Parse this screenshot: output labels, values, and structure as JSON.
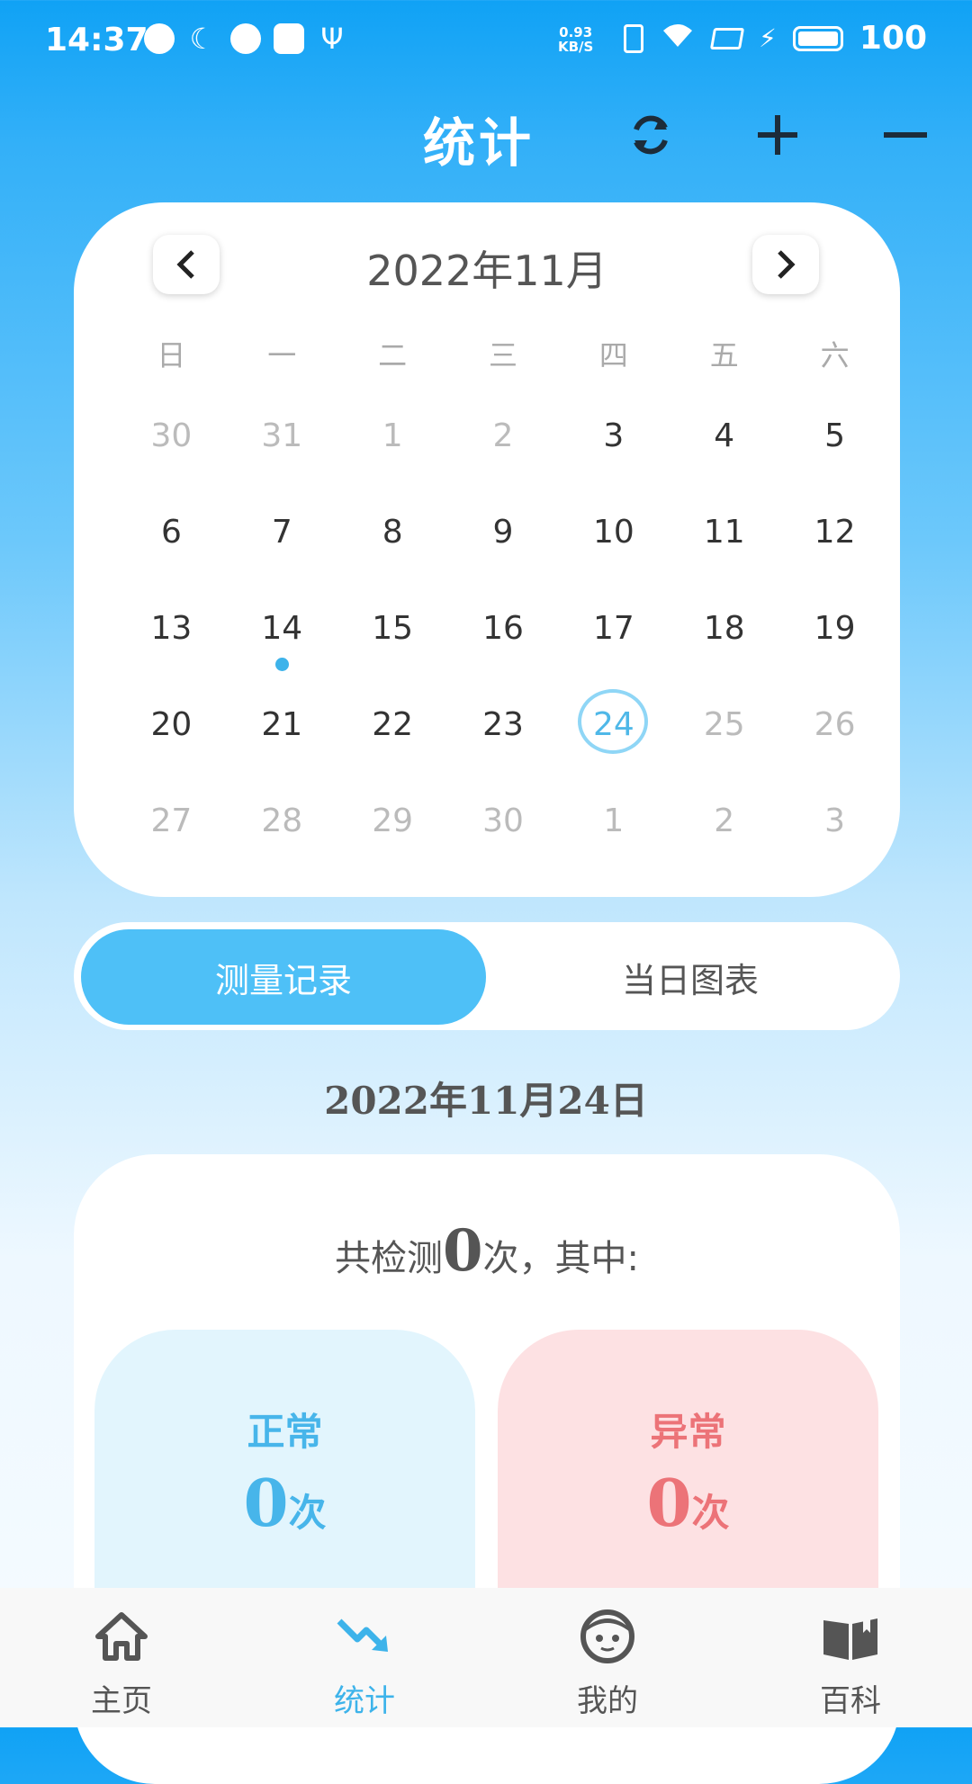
{
  "status_bar": {
    "time": "14:37",
    "net_speed_value": "0.93",
    "net_speed_unit": "KB/S",
    "battery": "100"
  },
  "header": {
    "title": "统计",
    "icons": [
      "refresh-icon",
      "plus-icon",
      "minus-icon"
    ]
  },
  "calendar": {
    "title": "2022年11月",
    "weekdays": [
      "日",
      "一",
      "二",
      "三",
      "四",
      "五",
      "六"
    ],
    "weeks": [
      [
        {
          "d": "30",
          "m": true
        },
        {
          "d": "31",
          "m": true
        },
        {
          "d": "1",
          "m": true
        },
        {
          "d": "2",
          "m": true
        },
        {
          "d": "3"
        },
        {
          "d": "4"
        },
        {
          "d": "5"
        }
      ],
      [
        {
          "d": "6"
        },
        {
          "d": "7"
        },
        {
          "d": "8"
        },
        {
          "d": "9"
        },
        {
          "d": "10"
        },
        {
          "d": "11"
        },
        {
          "d": "12"
        }
      ],
      [
        {
          "d": "13"
        },
        {
          "d": "14",
          "dot": true
        },
        {
          "d": "15"
        },
        {
          "d": "16"
        },
        {
          "d": "17"
        },
        {
          "d": "18"
        },
        {
          "d": "19"
        }
      ],
      [
        {
          "d": "20"
        },
        {
          "d": "21"
        },
        {
          "d": "22"
        },
        {
          "d": "23"
        },
        {
          "d": "24",
          "today": true
        },
        {
          "d": "25",
          "m": true
        },
        {
          "d": "26",
          "m": true
        }
      ],
      [
        {
          "d": "27",
          "m": true
        },
        {
          "d": "28",
          "m": true
        },
        {
          "d": "29",
          "m": true
        },
        {
          "d": "30",
          "m": true
        },
        {
          "d": "1",
          "m": true
        },
        {
          "d": "2",
          "m": true
        },
        {
          "d": "3",
          "m": true
        }
      ]
    ]
  },
  "tabs": {
    "records": "测量记录",
    "chart": "当日图表"
  },
  "selected_date": "2022年11月24日",
  "summary": {
    "prefix": "共检测",
    "count": "0",
    "suffix": "次，其中:",
    "normal_label": "正常",
    "normal_count": "0",
    "abnormal_label": "异常",
    "abnormal_count": "0",
    "unit": "次"
  },
  "colors": {
    "accent": "#4ec0f7",
    "normal": "#47b5ea",
    "abnormal": "#ec7378"
  },
  "bottom_nav": {
    "home": "主页",
    "stats": "统计",
    "mine": "我的",
    "wiki": "百科"
  }
}
